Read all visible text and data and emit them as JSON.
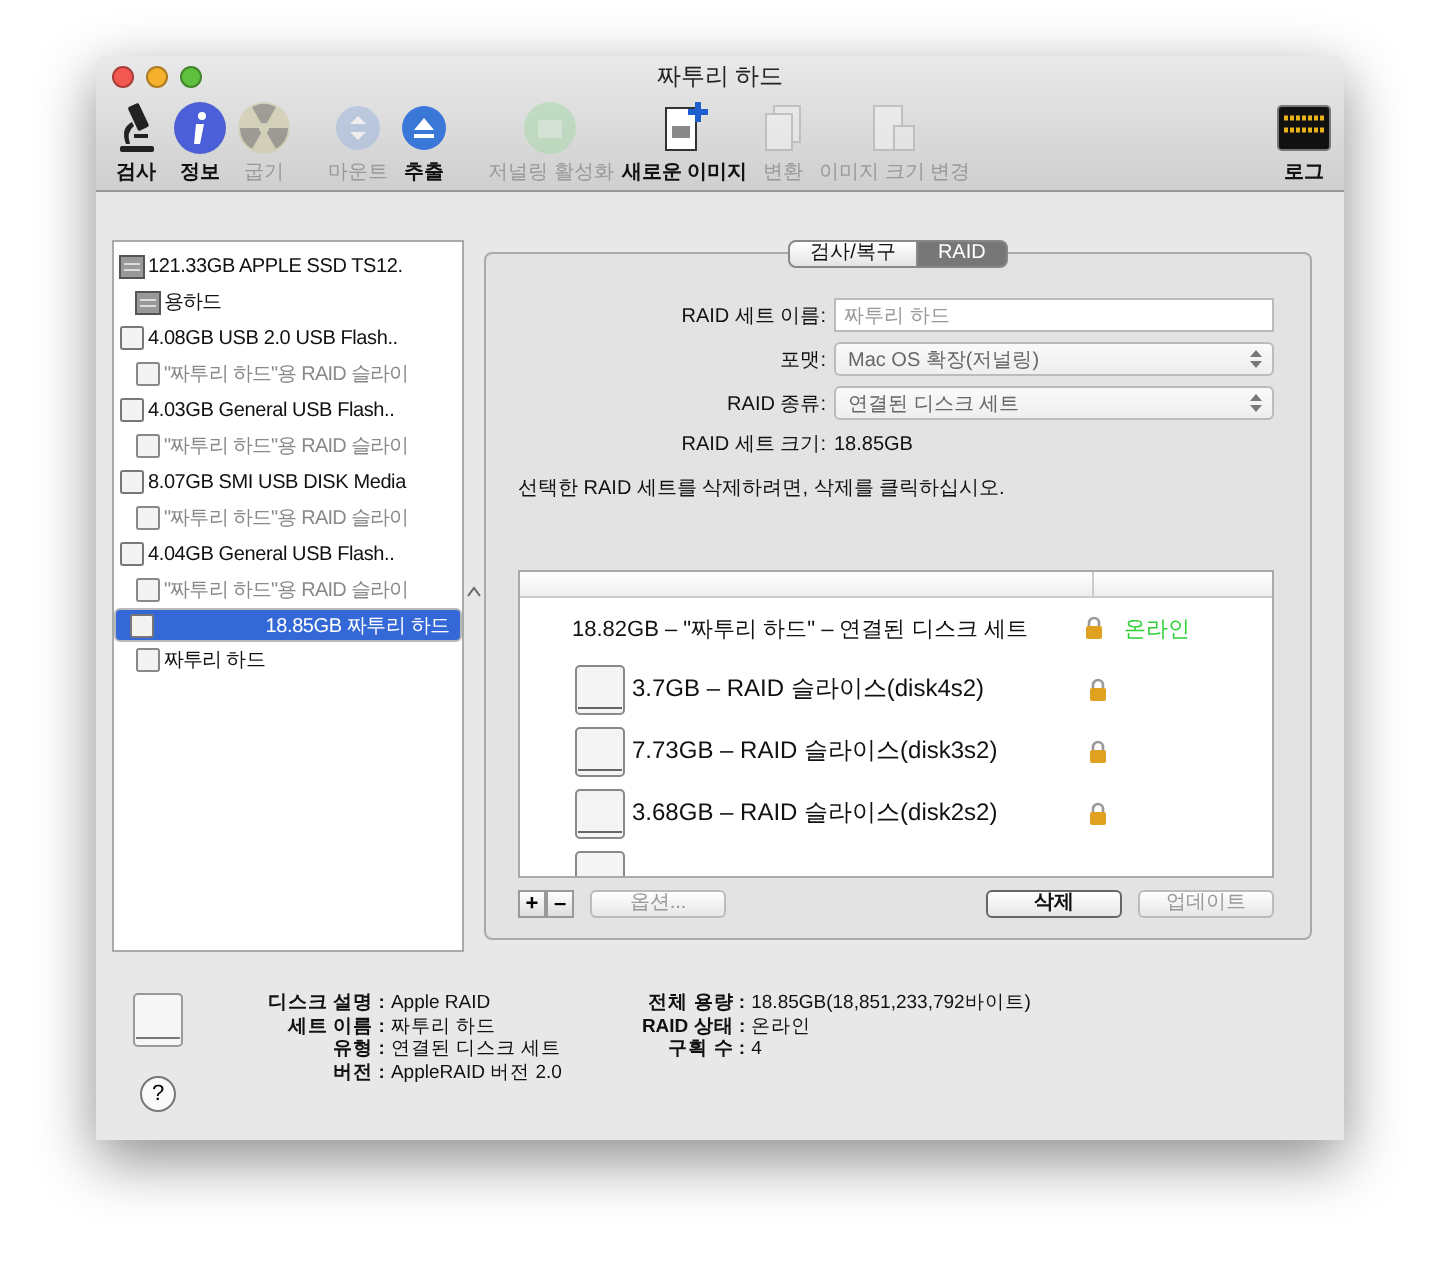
{
  "window": {
    "title": "짜투리 하드"
  },
  "toolbar": [
    {
      "label": "검사",
      "disabled": false
    },
    {
      "label": "정보",
      "disabled": false
    },
    {
      "label": "굽기",
      "disabled": true
    },
    {
      "label": "마운트",
      "disabled": true
    },
    {
      "label": "추출",
      "disabled": false
    },
    {
      "label": "저널링 활성화",
      "disabled": true
    },
    {
      "label": "새로운 이미지",
      "disabled": false
    },
    {
      "label": "변환",
      "disabled": true
    },
    {
      "label": "이미지 크기 변경",
      "disabled": true
    },
    {
      "label": "로그",
      "disabled": false
    }
  ],
  "sidebar": {
    "items": [
      {
        "label": "121.33GB APPLE SSD TS12.",
        "kind": "internal",
        "selected": false,
        "disabled": false,
        "children": [
          {
            "label": "용하드",
            "kind": "internal",
            "selected": false,
            "disabled": false
          }
        ]
      },
      {
        "label": "4.08GB USB 2.0 USB Flash..",
        "kind": "external",
        "selected": false,
        "disabled": false,
        "children": [
          {
            "label": "\"짜투리 하드\"용 RAID 슬라이",
            "kind": "external",
            "selected": false,
            "disabled": true
          }
        ]
      },
      {
        "label": "4.03GB General USB Flash..",
        "kind": "external",
        "selected": false,
        "disabled": false,
        "children": [
          {
            "label": "\"짜투리 하드\"용 RAID 슬라이",
            "kind": "external",
            "selected": false,
            "disabled": true
          }
        ]
      },
      {
        "label": "8.07GB SMI USB DISK Media",
        "kind": "external",
        "selected": false,
        "disabled": false,
        "children": [
          {
            "label": "\"짜투리 하드\"용 RAID 슬라이",
            "kind": "external",
            "selected": false,
            "disabled": true
          }
        ]
      },
      {
        "label": "4.04GB General USB Flash..",
        "kind": "external",
        "selected": false,
        "disabled": false,
        "children": [
          {
            "label": "\"짜투리 하드\"용 RAID 슬라이",
            "kind": "external",
            "selected": false,
            "disabled": true
          }
        ]
      },
      {
        "label": "18.85GB 짜투리 하드",
        "kind": "external",
        "selected": true,
        "disabled": false,
        "children": [
          {
            "label": "짜투리 하드",
            "kind": "external",
            "selected": false,
            "disabled": false
          }
        ]
      }
    ]
  },
  "tabs": [
    {
      "label": "검사/복구",
      "selected": false
    },
    {
      "label": "RAID",
      "selected": true
    }
  ],
  "raid_form": {
    "name_label": "RAID 세트 이름:",
    "name_value": "짜투리 하드",
    "format_label": "포맷:",
    "format_value": "Mac OS 확장(저널링)",
    "type_label": "RAID 종류:",
    "type_value": "연결된 디스크 세트",
    "size_label": "RAID 세트 크기:",
    "size_value": "18.85GB",
    "hint": "선택한 RAID 세트를 삭제하려면, 삭제를 클릭하십시오."
  },
  "raid_list": {
    "rows": [
      {
        "kind": "set",
        "label": "18.82GB – \"짜투리 하드\" – 연결된 디스크 세트",
        "locked": true,
        "status": "온라인"
      },
      {
        "kind": "slice",
        "label": "3.7GB – RAID 슬라이스(disk4s2)",
        "locked": true
      },
      {
        "kind": "slice",
        "label": "7.73GB – RAID 슬라이스(disk3s2)",
        "locked": true
      },
      {
        "kind": "slice",
        "label": "3.68GB – RAID 슬라이스(disk2s2)",
        "locked": true
      }
    ]
  },
  "list_buttons": [
    {
      "label": "+",
      "kind": "add",
      "disabled": false
    },
    {
      "label": "–",
      "kind": "remove",
      "disabled": false
    },
    {
      "label": "옵션...",
      "kind": "options",
      "disabled": true
    },
    {
      "label": "삭제",
      "kind": "delete",
      "disabled": false
    },
    {
      "label": "업데이트",
      "kind": "update",
      "disabled": true
    }
  ],
  "info": {
    "left": [
      {
        "label": "디스크 설명 :",
        "value": "Apple RAID"
      },
      {
        "label": "세트 이름 :",
        "value": "짜투리 하드"
      },
      {
        "label": "유형 :",
        "value": "연결된 디스크 세트"
      },
      {
        "label": "버전 :",
        "value": "AppleRAID 버전 2.0"
      }
    ],
    "right": [
      {
        "label": "전체 용량 :",
        "value": "18.85GB(18,851,233,792바이트)"
      },
      {
        "label": "RAID 상태 :",
        "value": "온라인"
      },
      {
        "label": "구획 수 :",
        "value": "4"
      }
    ]
  },
  "help_button": {
    "label": "?"
  }
}
